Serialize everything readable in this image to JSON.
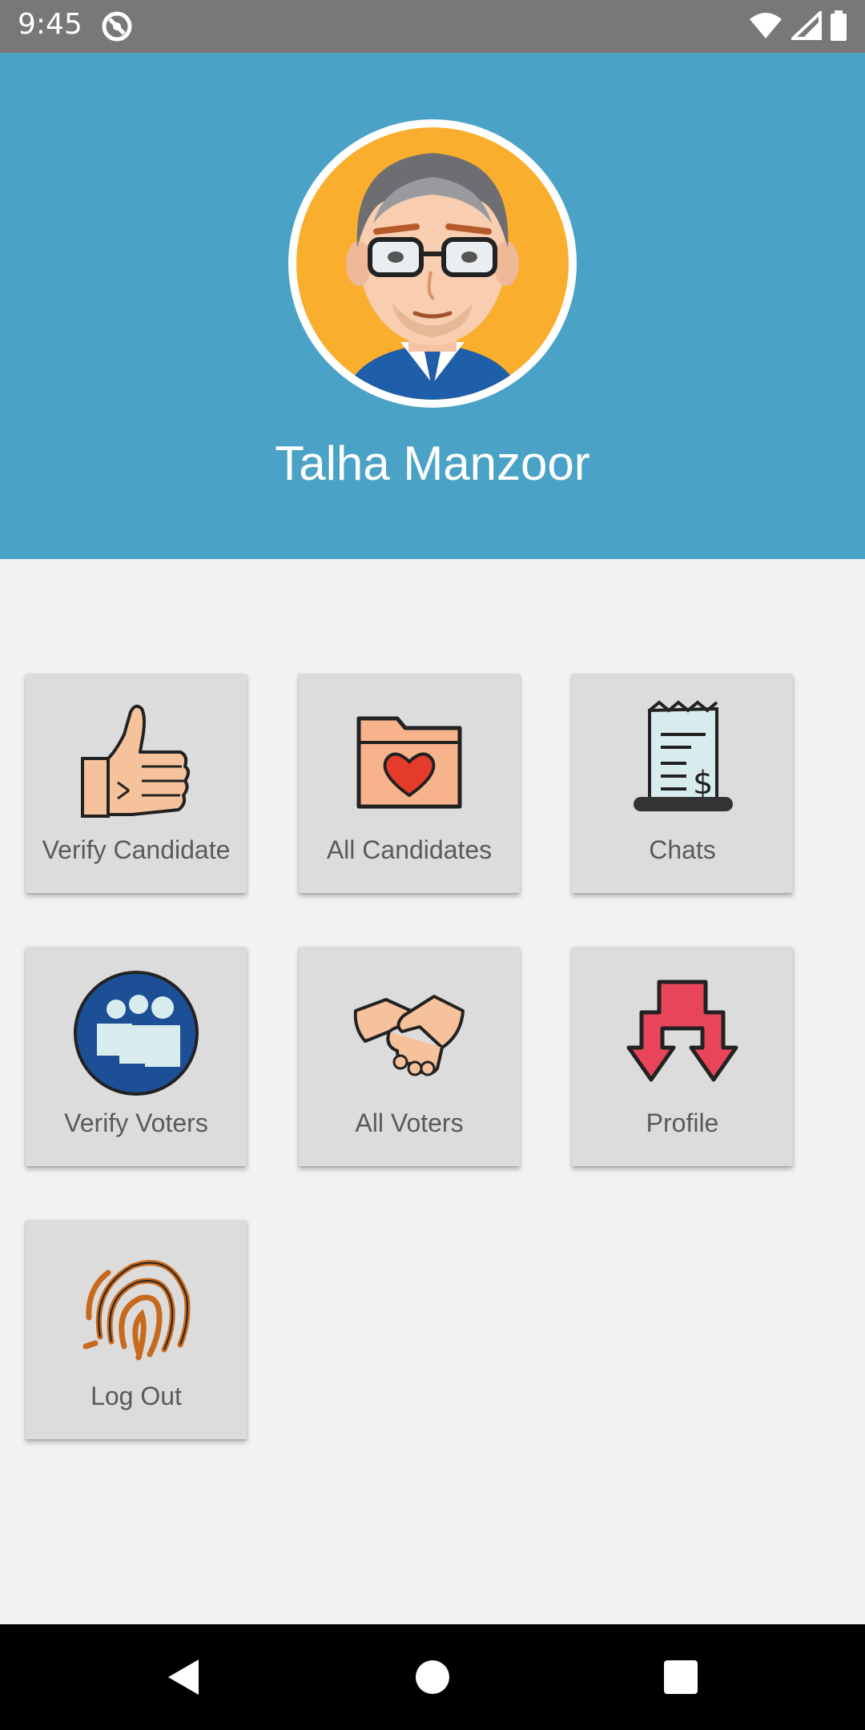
{
  "status_bar": {
    "time": "9:45",
    "icons": [
      "app-notification-icon",
      "wifi-icon",
      "signal-icon",
      "battery-icon"
    ]
  },
  "header": {
    "background_color": "#4aa3c6",
    "avatar_icon": "cartoon-man-avatar",
    "user_name": "Talha Manzoor"
  },
  "menu": {
    "tiles": [
      {
        "label": "Verify Candidate",
        "icon": "thumbs-up-icon"
      },
      {
        "label": "All Candidates",
        "icon": "heart-folder-icon"
      },
      {
        "label": "Chats",
        "icon": "receipt-icon"
      },
      {
        "label": "Verify Voters",
        "icon": "people-group-icon"
      },
      {
        "label": "All Voters",
        "icon": "handshake-icon"
      },
      {
        "label": "Profile",
        "icon": "split-arrows-icon"
      },
      {
        "label": "Log Out",
        "icon": "fingerprint-icon"
      }
    ]
  },
  "nav_bar": {
    "icons": [
      "back-icon",
      "home-icon",
      "recents-icon"
    ]
  }
}
